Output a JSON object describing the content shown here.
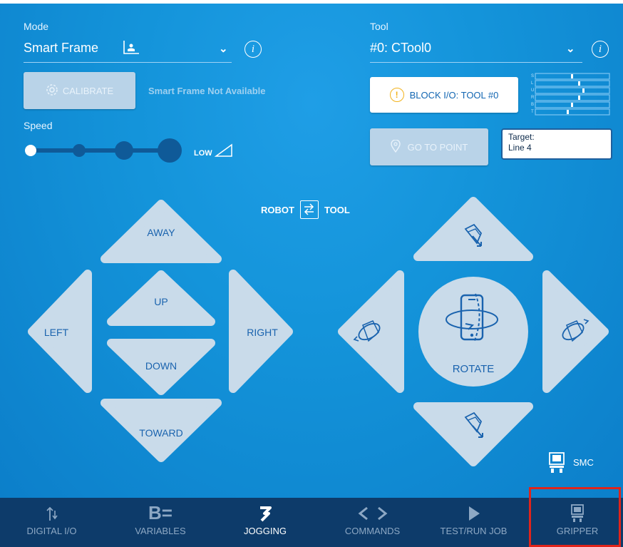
{
  "mode": {
    "label": "Mode",
    "value": "Smart Frame"
  },
  "tool": {
    "label": "Tool",
    "value": "#0: CTool0"
  },
  "calibrate": {
    "label": "CALIBRATE",
    "note": "Smart Frame Not Available"
  },
  "block_io": {
    "label": "BLOCK I/O: TOOL #0",
    "bars": [
      "S",
      "L",
      "U",
      "R",
      "B",
      "T"
    ]
  },
  "speed": {
    "label": "Speed",
    "level_label": "LOW"
  },
  "go_to_point": {
    "label": "GO TO POINT",
    "tooltip_line1": "Target:",
    "tooltip_line2": "Line 4"
  },
  "frame_toggle": {
    "left": "ROBOT",
    "right": "TOOL"
  },
  "translate": {
    "away": "AWAY",
    "up": "UP",
    "left": "LEFT",
    "right": "RIGHT",
    "down": "DOWN",
    "toward": "TOWARD"
  },
  "rotate": {
    "label": "ROTATE"
  },
  "gripper_indicator": {
    "label": "SMC"
  },
  "nav": [
    {
      "label": "DIGITAL I/O",
      "icon": "digital-io-icon",
      "active": false
    },
    {
      "label": "VARIABLES",
      "icon": "variables-icon",
      "active": false
    },
    {
      "label": "JOGGING",
      "icon": "jogging-icon",
      "active": true
    },
    {
      "label": "COMMANDS",
      "icon": "commands-icon",
      "active": false
    },
    {
      "label": "TEST/RUN JOB",
      "icon": "play-icon",
      "active": false
    },
    {
      "label": "GRIPPER",
      "icon": "gripper-icon",
      "active": false
    }
  ],
  "colors": {
    "panel": "#1494da",
    "bottom_bar": "#0d3b6a",
    "jog_button": "#c9dbea",
    "jog_text": "#1a63ae",
    "highlight": "#e0241b"
  }
}
